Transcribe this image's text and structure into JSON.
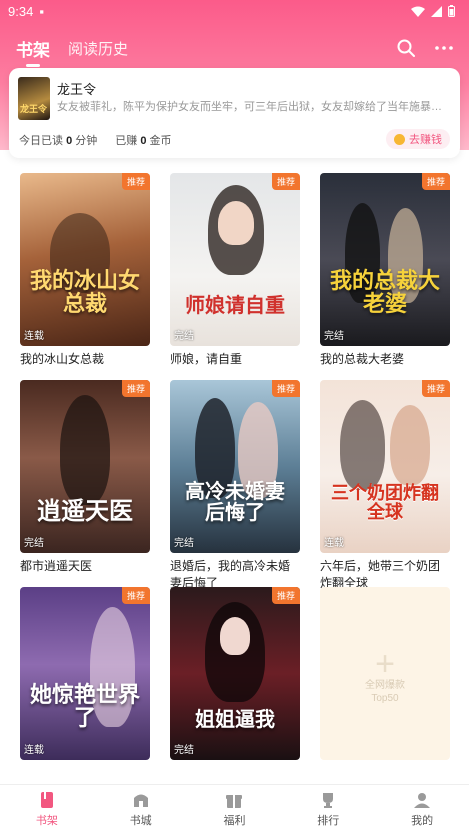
{
  "status_bar": {
    "time": "9:34"
  },
  "nav": {
    "tabs": [
      {
        "label": "书架"
      },
      {
        "label": "阅读历史"
      }
    ]
  },
  "recent": {
    "cover_text": "龙王令",
    "title": "龙王令",
    "description": "女友被菲礼，陈平为保护女友而坐牢，可三年后出狱，女友却嫁给了当年施暴者..........陈平觉悟",
    "today_read_prefix": "今日已读",
    "today_read_value": "0",
    "today_read_unit": "分钟",
    "earned_prefix": "已赚",
    "earned_value": "0",
    "earned_unit": "金币",
    "earn_button": "去赚钱"
  },
  "books": [
    {
      "title": "我的冰山女总裁",
      "cover_text": "我的冰山女总裁",
      "status": "连载",
      "badge": "推荐"
    },
    {
      "title": "师娘，请自重",
      "cover_text": "师娘请自重",
      "status": "完结",
      "badge": "推荐"
    },
    {
      "title": "我的总裁大老婆",
      "cover_text": "我的总裁大老婆",
      "status": "完结",
      "badge": "推荐"
    },
    {
      "title": "都市逍遥天医",
      "cover_text": "逍遥天医",
      "status": "完结",
      "badge": "推荐"
    },
    {
      "title": "退婚后，我的高冷未婚妻后悔了",
      "cover_text": "高冷未婚妻后悔了",
      "status": "完结",
      "badge": "推荐"
    },
    {
      "title": "六年后，她带三个奶团炸翻全球",
      "cover_text": "三个奶团炸翻全球",
      "status": "连载",
      "badge": "推荐"
    },
    {
      "title": "",
      "cover_text": "她惊艳世界了",
      "status": "连载",
      "badge": "推荐"
    },
    {
      "title": "",
      "cover_text": "姐姐逼我",
      "status": "完结",
      "badge": "推荐"
    }
  ],
  "add_card": {
    "line1": "全网爆款",
    "line2": "Top50"
  },
  "bottom_nav": [
    {
      "label": "书架"
    },
    {
      "label": "书城"
    },
    {
      "label": "福利"
    },
    {
      "label": "排行"
    },
    {
      "label": "我的"
    }
  ],
  "colors": {
    "accent": "#f25780",
    "header_top": "#fb5b8a",
    "badge": "#f2752e"
  }
}
